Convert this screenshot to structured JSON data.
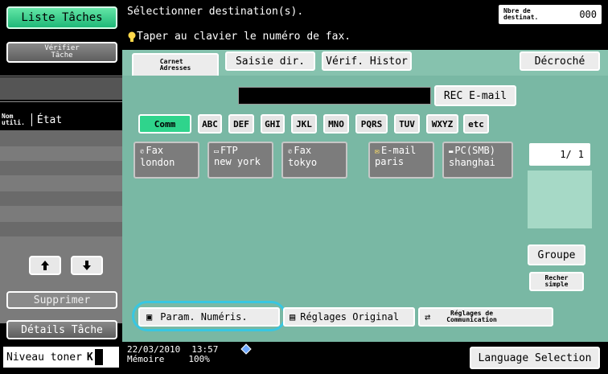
{
  "left_panel": {
    "job_list_label": "Liste Tâches",
    "check_job_label": "Vérifier\nTâche",
    "column_user": "Nom\nutili.",
    "column_status": "État",
    "delete_label": "Supprimer",
    "job_details_label": "Détails Tâche",
    "toner_label": "Niveau toner",
    "toner_color": "K"
  },
  "header": {
    "instruction": "Sélectionner destination(s).",
    "hint": "Taper au clavier le numéro de fax.",
    "dest_count_label": "Nbre de\ndestinat.",
    "dest_count_value": "000"
  },
  "tabs": {
    "address_book": "Carnet\nAdresses",
    "direct_input": "Saisie dir.",
    "history": "Vérif. Histor",
    "off_hook": "Décroché"
  },
  "search": {
    "value": "",
    "rec_email_label": "REC E-mail"
  },
  "index_tabs": [
    "Comm",
    "ABC",
    "DEF",
    "GHI",
    "JKL",
    "MNO",
    "PQRS",
    "TUV",
    "WXYZ",
    "etc"
  ],
  "destinations": [
    {
      "type": "Fax",
      "icon": "fax-icon",
      "name": "london"
    },
    {
      "type": "FTP",
      "icon": "ftp-icon",
      "name": "new york"
    },
    {
      "type": "Fax",
      "icon": "fax-icon",
      "name": "tokyo"
    },
    {
      "type": "E-mail",
      "icon": "email-icon",
      "name": "paris"
    },
    {
      "type": "PC(SMB)",
      "icon": "pc-smb-icon",
      "name": "shanghai"
    }
  ],
  "pager": {
    "current": "1/",
    "total": "1"
  },
  "right_buttons": {
    "group_label": "Groupe",
    "simple_search_label": "Recher\nsimple"
  },
  "bottom_buttons": {
    "scan_settings": "Param. Numéris.",
    "original_settings": "Réglages Original",
    "comm_settings": "Réglages de\nCommunication"
  },
  "status": {
    "date": "22/03/2010",
    "time": "13:57",
    "memory_label": "Mémoire",
    "memory_value": "100%",
    "language_label": "Language Selection"
  },
  "colors": {
    "panel_bg": "#79b8a4",
    "selected_green": "#2fd48c",
    "highlight_ring": "#37c7e2"
  }
}
